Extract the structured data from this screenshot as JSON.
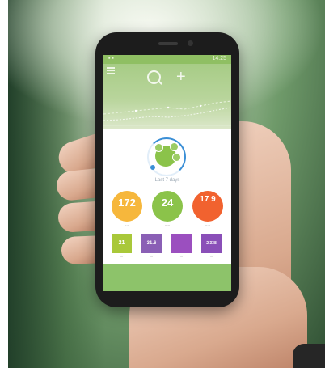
{
  "status": {
    "time": "14:25",
    "left": "▪ ▪"
  },
  "header": {
    "menu_icon": "menu-icon",
    "search_icon": "search-icon",
    "plus_icon": "plus-icon",
    "plus_glyph": "+"
  },
  "summary": {
    "caption": "Last 7 days"
  },
  "stats": [
    {
      "value": "172",
      "color": "#f6b73c"
    },
    {
      "value": "24",
      "color": "#8bc34a"
    },
    {
      "value": "17 9",
      "color": "#f1622f"
    }
  ],
  "tiles": [
    {
      "value": "21",
      "color": "#a9c83a"
    },
    {
      "value": "31.6",
      "color": "#8a5fb5"
    },
    {
      "value": "",
      "color": "#9b4fbf"
    },
    {
      "value": "2,338",
      "color": "#8a4fb8"
    }
  ],
  "footer": {
    "label": ""
  }
}
